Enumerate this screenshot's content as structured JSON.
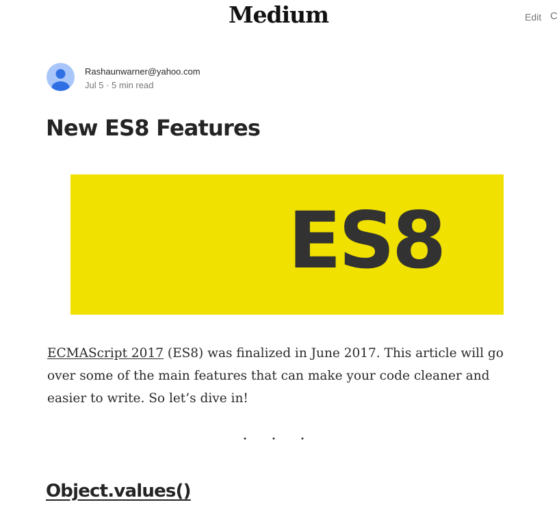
{
  "header": {
    "logo": "Medium",
    "edit_label": "Edit",
    "truncated_label": "C"
  },
  "author": {
    "name": "Rashaunwarner@yahoo.com",
    "date": "Jul 5",
    "separator": " · ",
    "read_time": "5 min read"
  },
  "article": {
    "title": "New ES8 Features",
    "hero_text": "ES8",
    "intro_link": "ECMAScript 2017",
    "intro_rest": " (ES8) was finalized in June 2017. This article will go over some of the main features that can make your code cleaner and easier to write. So let’s dive in!",
    "section_separator": "· · ·",
    "section_heading": "Object.values()"
  },
  "colors": {
    "hero_background": "#f0e101",
    "hero_text": "#323232",
    "avatar_background": "#a8c6fa",
    "avatar_figure": "#2f6fe4"
  }
}
